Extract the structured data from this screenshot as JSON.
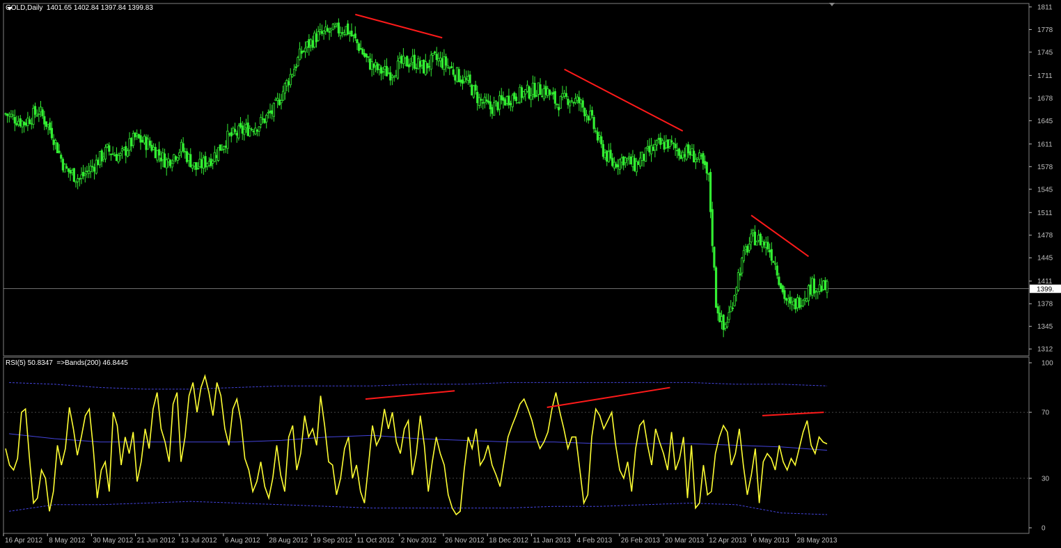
{
  "header": {
    "symbol": "GOLD,Daily",
    "ohlc": "1401.65 1402.84 1397.84 1399.83"
  },
  "rsi_header": {
    "label": "RSI(5) 50.8347",
    "bands": "=>Bands(200) 46.8445"
  },
  "current_price_label": "1399.",
  "colors": {
    "background": "#000000",
    "candles": "#33ee33",
    "trendlines": "#ff1a1a",
    "rsi_line": "#ffff33",
    "bands": "#4444dd",
    "axis": "#c0c0c0",
    "price_line": "#b0b0b0"
  },
  "chart_data": [
    {
      "type": "candlestick",
      "title": "GOLD,Daily",
      "y_axis_ticks": [
        1811,
        1778,
        1745,
        1711,
        1678,
        1645,
        1611,
        1578,
        1545,
        1511,
        1478,
        1445,
        1411,
        1378,
        1345,
        1312
      ],
      "ylim": [
        1302,
        1816
      ],
      "x_axis_labels": [
        "16 Apr 2012",
        "8 May 2012",
        "30 May 2012",
        "21 Jun 2012",
        "13 Jul 2012",
        "6 Aug 2012",
        "28 Aug 2012",
        "19 Sep 2012",
        "11 Oct 2012",
        "2 Nov 2012",
        "26 Nov 2012",
        "18 Dec 2012",
        "11 Jan 2013",
        "4 Feb 2013",
        "26 Feb 2013",
        "20 Mar 2013",
        "12 Apr 2013",
        "6 May 2013",
        "28 May 2013"
      ],
      "current_price": 1399.83,
      "close_path": [
        [
          0,
          1655
        ],
        [
          10,
          1642
        ],
        [
          18,
          1660
        ],
        [
          25,
          1628
        ],
        [
          32,
          1575
        ],
        [
          40,
          1560
        ],
        [
          47,
          1578
        ],
        [
          55,
          1602
        ],
        [
          62,
          1592
        ],
        [
          70,
          1620
        ],
        [
          78,
          1610
        ],
        [
          87,
          1585
        ],
        [
          95,
          1605
        ],
        [
          103,
          1575
        ],
        [
          112,
          1592
        ],
        [
          120,
          1620
        ],
        [
          128,
          1630
        ],
        [
          137,
          1640
        ],
        [
          145,
          1660
        ],
        [
          152,
          1700
        ],
        [
          160,
          1745
        ],
        [
          168,
          1768
        ],
        [
          176,
          1775
        ],
        [
          184,
          1780
        ],
        [
          190,
          1758
        ],
        [
          196,
          1730
        ],
        [
          202,
          1718
        ],
        [
          208,
          1715
        ],
        [
          214,
          1728
        ],
        [
          220,
          1732
        ],
        [
          226,
          1722
        ],
        [
          232,
          1735
        ],
        [
          238,
          1728
        ],
        [
          244,
          1712
        ],
        [
          250,
          1700
        ],
        [
          256,
          1675
        ],
        [
          262,
          1663
        ],
        [
          268,
          1672
        ],
        [
          274,
          1680
        ],
        [
          280,
          1685
        ],
        [
          286,
          1690
        ],
        [
          292,
          1690
        ],
        [
          298,
          1670
        ],
        [
          304,
          1678
        ],
        [
          310,
          1672
        ],
        [
          316,
          1650
        ],
        [
          322,
          1605
        ],
        [
          328,
          1582
        ],
        [
          334,
          1590
        ],
        [
          340,
          1580
        ],
        [
          346,
          1595
        ],
        [
          352,
          1608
        ],
        [
          358,
          1612
        ],
        [
          364,
          1600
        ],
        [
          370,
          1598
        ],
        [
          376,
          1585
        ],
        [
          380,
          1560
        ],
        [
          384,
          1380
        ],
        [
          388,
          1340
        ],
        [
          392,
          1370
        ],
        [
          396,
          1420
        ],
        [
          400,
          1455
        ],
        [
          404,
          1475
        ],
        [
          408,
          1470
        ],
        [
          412,
          1462
        ],
        [
          416,
          1438
        ],
        [
          420,
          1395
        ],
        [
          424,
          1372
        ],
        [
          428,
          1380
        ],
        [
          432,
          1392
        ],
        [
          436,
          1405
        ],
        [
          440,
          1402
        ],
        [
          444,
          1400
        ]
      ],
      "trendlines": [
        {
          "from": [
            189,
            1800
          ],
          "to": [
            236,
            1766
          ]
        },
        {
          "from": [
            302,
            1720
          ],
          "to": [
            366,
            1630
          ]
        },
        {
          "from": [
            403,
            1507
          ],
          "to": [
            434,
            1447
          ]
        }
      ]
    },
    {
      "type": "line",
      "title": "RSI(5)",
      "series": [
        {
          "name": "RSI(5)",
          "values": [
            48,
            38,
            35,
            42,
            70,
            72,
            42,
            15,
            18,
            35,
            30,
            10,
            22,
            50,
            38,
            48,
            73,
            60,
            44,
            55,
            68,
            72,
            48,
            18,
            35,
            40,
            22,
            70,
            62,
            38,
            55,
            45,
            58,
            28,
            40,
            60,
            48,
            72,
            82,
            60,
            52,
            40,
            75,
            82,
            40,
            55,
            80,
            88,
            70,
            85,
            92,
            82,
            68,
            88,
            80,
            60,
            50,
            72,
            78,
            65,
            42,
            35,
            22,
            28,
            40,
            25,
            18,
            30,
            50,
            32,
            22,
            55,
            62,
            35,
            45,
            68,
            55,
            60,
            50,
            80,
            62,
            40,
            38,
            20,
            30,
            48,
            55,
            30,
            38,
            22,
            15,
            38,
            62,
            50,
            55,
            72,
            60,
            70,
            52,
            45,
            60,
            65,
            32,
            45,
            68,
            50,
            22,
            40,
            55,
            45,
            38,
            20,
            12,
            8,
            10,
            35,
            55,
            48,
            60,
            38,
            42,
            50,
            38,
            32,
            25,
            40,
            55,
            62,
            68,
            75,
            78,
            72,
            65,
            55,
            48,
            52,
            58,
            72,
            82,
            70,
            60,
            48,
            55,
            55,
            35,
            15,
            20,
            55,
            72,
            68,
            60,
            65,
            70,
            50,
            35,
            30,
            40,
            22,
            48,
            62,
            65,
            50,
            38,
            60,
            52,
            45,
            35,
            58,
            35,
            42,
            55,
            18,
            50,
            12,
            15,
            38,
            20,
            22,
            45,
            55,
            62,
            58,
            38,
            45,
            60,
            38,
            20,
            32,
            48,
            15,
            40,
            45,
            42,
            35,
            50,
            40,
            35,
            42,
            38,
            48,
            58,
            65,
            50,
            45,
            55,
            52
          ]
        }
      ],
      "series_end_overrides": {
        "rsi_last": 50.83
      },
      "upper_band": [
        88,
        87,
        85,
        84,
        84,
        85,
        86,
        86,
        86,
        87,
        87,
        88,
        88,
        88,
        88,
        88,
        87,
        87,
        86
      ],
      "middle_band": [
        57,
        54,
        52,
        52,
        52,
        52,
        53,
        55,
        56,
        54,
        53,
        52,
        52,
        51,
        51,
        51,
        50,
        49,
        47
      ],
      "lower_band": [
        10,
        14,
        14,
        15,
        16,
        15,
        14,
        13,
        12,
        12,
        12,
        12,
        13,
        13,
        14,
        15,
        14,
        9,
        8
      ],
      "y_axis_ticks": [
        100,
        70,
        30,
        0
      ],
      "ylim": [
        0,
        100
      ],
      "trendlines": [
        {
          "from": [
            0.353,
            78
          ],
          "to": [
            0.44,
            83
          ]
        },
        {
          "from": [
            0.53,
            73
          ],
          "to": [
            0.65,
            85
          ]
        },
        {
          "from": [
            0.74,
            68
          ],
          "to": [
            0.8,
            70
          ]
        }
      ]
    }
  ]
}
